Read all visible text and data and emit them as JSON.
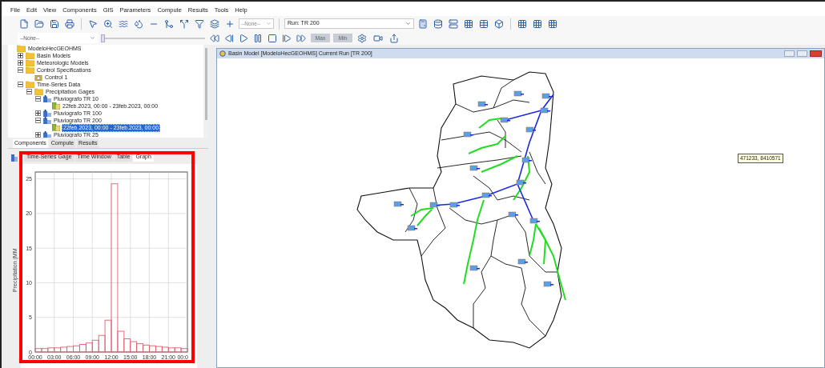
{
  "menu": [
    "File",
    "Edit",
    "View",
    "Components",
    "GIS",
    "Parameters",
    "Compute",
    "Results",
    "Tools",
    "Help"
  ],
  "toolbar": {
    "element_select": {
      "value": "--None--"
    },
    "run_select": {
      "value": "Run: TR 200"
    }
  },
  "animation_bar": {
    "select": {
      "value": "--None--"
    },
    "slider": {
      "level": 0
    },
    "buttons": [
      {
        "label": "Max",
        "disabled": true
      },
      {
        "label": "Min",
        "disabled": true
      }
    ]
  },
  "tree": {
    "label": "ModeloHecGEOHMS",
    "kind": "folder",
    "children": [
      {
        "label": "Basin Models",
        "kind": "folder",
        "expanded": false,
        "selected": false
      },
      {
        "label": "Meteorologic Models",
        "kind": "folder",
        "expanded": false,
        "selected": false
      },
      {
        "label": "Control Specifications",
        "kind": "folder",
        "expanded": true,
        "selected": false,
        "children": [
          {
            "label": "Control 1",
            "kind": "control",
            "selected": false
          }
        ]
      },
      {
        "label": "Time-Series Data",
        "kind": "folder",
        "expanded": true,
        "selected": false,
        "children": [
          {
            "label": "Precipitation Gages",
            "kind": "folder",
            "expanded": true,
            "selected": false,
            "children": [
              {
                "label": "Pluviografo TR 10",
                "kind": "gage",
                "expanded": true,
                "selected": false,
                "children": [
                  {
                    "label": "22feb.2023, 00:00 - 23feb.2023, 00:00",
                    "kind": "window",
                    "selected": false
                  }
                ]
              },
              {
                "label": "Pluviografo TR 100",
                "kind": "gage",
                "expanded": false,
                "selected": false
              },
              {
                "label": "Pluviografo TR 200",
                "kind": "gage",
                "expanded": true,
                "selected": false,
                "children": [
                  {
                    "label": "22feb.2023, 00:00 - 23feb.2023, 00:00",
                    "kind": "window",
                    "selected": true
                  }
                ]
              },
              {
                "label": "Pluviografo TR 25",
                "kind": "gage",
                "expanded": false,
                "selected": false
              }
            ]
          }
        ]
      }
    ]
  },
  "panel_tabs": [
    {
      "label": "Components",
      "selected": true
    },
    {
      "label": "Compute",
      "selected": false
    },
    {
      "label": "Results",
      "selected": false
    }
  ],
  "editor_tabs": [
    {
      "label": "Time-Series Gage",
      "selected": false
    },
    {
      "label": "Time Window",
      "selected": false
    },
    {
      "label": "Table",
      "selected": false
    },
    {
      "label": "Graph",
      "selected": true
    }
  ],
  "graph": {
    "chart_data": {
      "type": "bar",
      "ylabel": "Precipitation (MM",
      "x": [
        0.5,
        1.5,
        2.5,
        3.5,
        4.5,
        5.5,
        6.5,
        7.5,
        8.5,
        9.5,
        10.5,
        11.5,
        12.5,
        13.5,
        14.5,
        15.5,
        16.5,
        17.5,
        18.5,
        19.5,
        20.5,
        21.5,
        22.5,
        23.5
      ],
      "values": [
        0.5,
        0.5,
        0.6,
        0.6,
        0.7,
        0.8,
        0.9,
        1.1,
        1.3,
        1.7,
        2.4,
        4.6,
        24.3,
        3.0,
        1.9,
        1.5,
        1.2,
        1.0,
        0.9,
        0.8,
        0.7,
        0.6,
        0.6,
        0.5
      ],
      "xlim": [
        0,
        24
      ],
      "ylim": [
        0,
        26
      ],
      "grid": true,
      "xticks": [
        {
          "value": 0,
          "label": "00:00"
        },
        {
          "value": 3,
          "label": "03:00"
        },
        {
          "value": 6,
          "label": "06:00"
        },
        {
          "value": 9,
          "label": "09:00"
        },
        {
          "value": 12,
          "label": "12:00"
        },
        {
          "value": 15,
          "label": "15:00"
        },
        {
          "value": 18,
          "label": "18:00"
        },
        {
          "value": 21,
          "label": "21:00"
        },
        {
          "value": 24,
          "label": "00:0"
        }
      ],
      "yticks": [
        0,
        5,
        10,
        15,
        20,
        25
      ]
    }
  },
  "map_window": {
    "title": "Basin Model [ModeloHecGEOHMS] Current Run [TR 200]",
    "coordinates": "471233, 8410571"
  }
}
